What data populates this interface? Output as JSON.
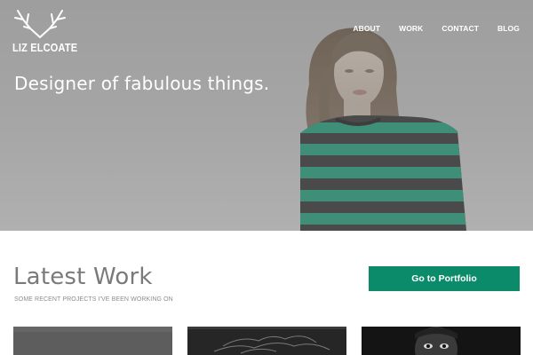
{
  "site": {
    "logo_text": "LIZ ELCOATE",
    "logo_icon": "antlers-icon"
  },
  "nav": {
    "items": [
      {
        "label": "ABOUT"
      },
      {
        "label": "WORK"
      },
      {
        "label": "CONTACT"
      },
      {
        "label": "BLOG"
      }
    ]
  },
  "hero": {
    "tagline": "Designer of fabulous things."
  },
  "latest_work": {
    "title": "Latest Work",
    "subtitle": "SOME RECENT PROJECTS I'VE BEEN WORKING ON",
    "button_label": "Go to Portfolio"
  },
  "colors": {
    "accent": "#0c8b6b",
    "hero_overlay": "#a1a1a1",
    "sweater_stripe": "#3f8f78"
  }
}
